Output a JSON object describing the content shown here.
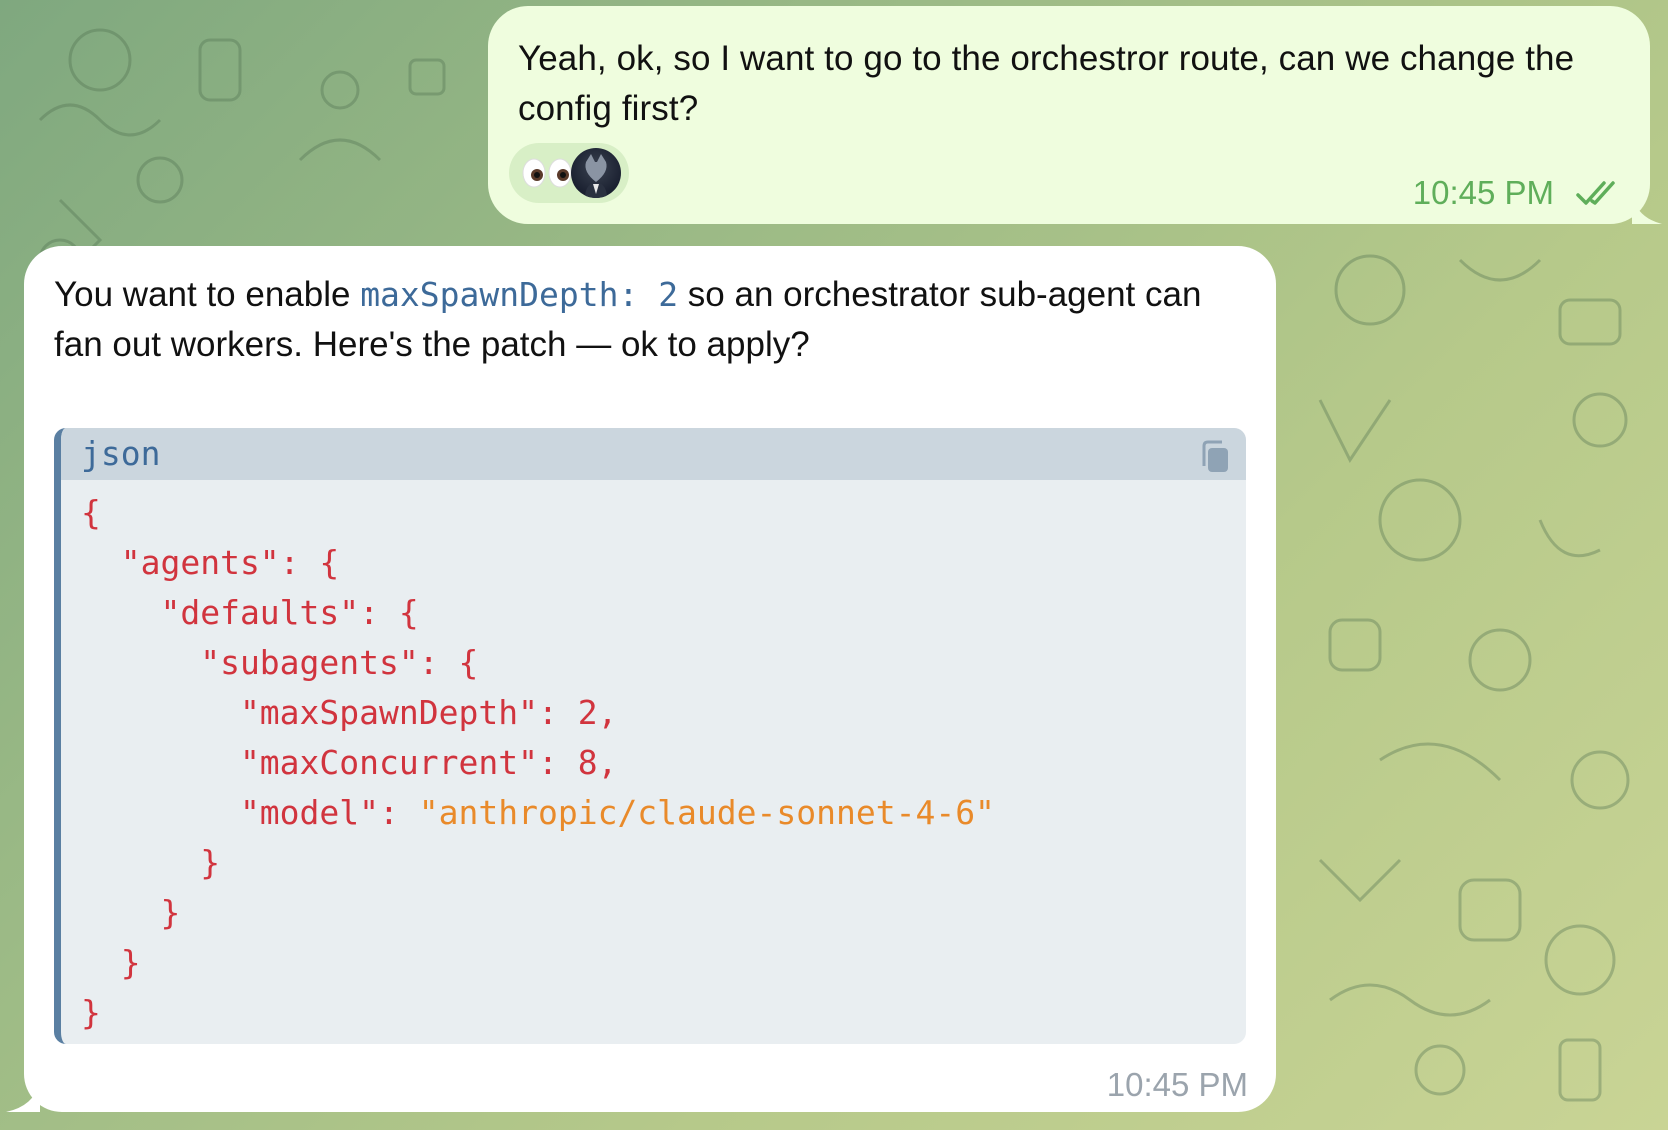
{
  "outgoing": {
    "text": "Yeah, ok, so I want to go to the orchestror route, can we change the config first?",
    "reaction_emoji": "👀",
    "time": "10:45 PM"
  },
  "incoming": {
    "text_pre": "You want to enable ",
    "inline_code": "maxSpawnDepth: 2",
    "text_post": " so an orchestrator sub-agent can fan out workers. Here's the patch — ok to apply?",
    "code": {
      "language": "json",
      "lines": [
        "{",
        "  \"agents\": {",
        "    \"defaults\": {",
        "      \"subagents\": {",
        "        \"maxSpawnDepth\": 2,",
        "        \"maxConcurrent\": 8,",
        "        \"model\": ",
        "      }",
        "    }",
        "  }",
        "}"
      ],
      "model_value": "\"anthropic/claude-sonnet-4-6\""
    },
    "time": "10:45 PM"
  },
  "colors": {
    "outgoing_bubble": "#effdde",
    "incoming_bubble": "#ffffff",
    "code_key": "#d1343e",
    "code_string": "#e98a2a",
    "inline_code": "#3d6a99",
    "time_outgoing": "#5fae5a",
    "time_incoming": "#9ba4ad"
  },
  "icons": [
    "eyes-emoji",
    "wolf-avatar",
    "double-check-icon",
    "copy-icon"
  ]
}
